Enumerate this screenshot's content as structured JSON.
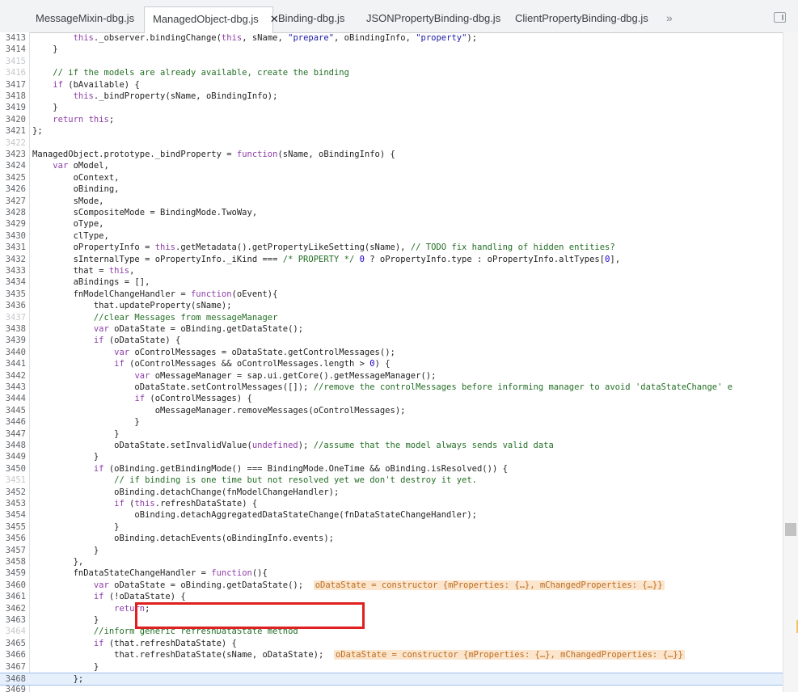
{
  "tabs": [
    {
      "label": "MessageMixin-dbg.js",
      "active": false
    },
    {
      "label": "ManagedObject-dbg.js",
      "active": true
    },
    {
      "label": "Binding-dbg.js",
      "active": false
    },
    {
      "label": "JSONPropertyBinding-dbg.js",
      "active": false
    },
    {
      "label": "ClientPropertyBinding-dbg.js",
      "active": false
    }
  ],
  "close_glyph": "✕",
  "overflow_glyph": "»",
  "execution_line": 3468,
  "lines": [
    {
      "n": "3413",
      "text": "\t\tthis._observer.bindingChange(this, sName, \"prepare\", oBindingInfo, \"property\");"
    },
    {
      "n": "3414",
      "text": "\t}"
    },
    {
      "n": "3415",
      "text": ""
    },
    {
      "n": "3416",
      "text": "\t// if the models are already available, create the binding"
    },
    {
      "n": "3417",
      "text": "\tif (bAvailable) {"
    },
    {
      "n": "3418",
      "text": "\t\tthis._bindProperty(sName, oBindingInfo);"
    },
    {
      "n": "3419",
      "text": "\t}"
    },
    {
      "n": "3420",
      "text": "\treturn this;"
    },
    {
      "n": "3421",
      "text": "};"
    },
    {
      "n": "3422",
      "text": ""
    },
    {
      "n": "3423",
      "text": "ManagedObject.prototype._bindProperty = function(sName, oBindingInfo) {"
    },
    {
      "n": "3424",
      "text": "\tvar oModel,"
    },
    {
      "n": "3425",
      "text": "\t\toContext,"
    },
    {
      "n": "3426",
      "text": "\t\toBinding,"
    },
    {
      "n": "3427",
      "text": "\t\tsMode,"
    },
    {
      "n": "3428",
      "text": "\t\tsCompositeMode = BindingMode.TwoWay,"
    },
    {
      "n": "3429",
      "text": "\t\toType,"
    },
    {
      "n": "3430",
      "text": "\t\tclType,"
    },
    {
      "n": "3431",
      "text": "\t\toPropertyInfo = this.getMetadata().getPropertyLikeSetting(sName), // TODO fix handling of hidden entities?"
    },
    {
      "n": "3432",
      "text": "\t\tsInternalType = oPropertyInfo._iKind === /* PROPERTY */ 0 ? oPropertyInfo.type : oPropertyInfo.altTypes[0],"
    },
    {
      "n": "3433",
      "text": "\t\tthat = this,"
    },
    {
      "n": "3434",
      "text": "\t\taBindings = [],"
    },
    {
      "n": "3435",
      "text": "\t\tfnModelChangeHandler = function(oEvent){"
    },
    {
      "n": "3436",
      "text": "\t\t\tthat.updateProperty(sName);"
    },
    {
      "n": "3437",
      "text": "\t\t\t//clear Messages from messageManager"
    },
    {
      "n": "3438",
      "text": "\t\t\tvar oDataState = oBinding.getDataState();"
    },
    {
      "n": "3439",
      "text": "\t\t\tif (oDataState) {"
    },
    {
      "n": "3440",
      "text": "\t\t\t\tvar oControlMessages = oDataState.getControlMessages();"
    },
    {
      "n": "3441",
      "text": "\t\t\t\tif (oControlMessages && oControlMessages.length > 0) {"
    },
    {
      "n": "3442",
      "text": "\t\t\t\t\tvar oMessageManager = sap.ui.getCore().getMessageManager();"
    },
    {
      "n": "3443",
      "text": "\t\t\t\t\toDataState.setControlMessages([]); //remove the controlMessages before informing manager to avoid 'dataStateChange' e"
    },
    {
      "n": "3444",
      "text": "\t\t\t\t\tif (oControlMessages) {"
    },
    {
      "n": "3445",
      "text": "\t\t\t\t\t\toMessageManager.removeMessages(oControlMessages);"
    },
    {
      "n": "3446",
      "text": "\t\t\t\t\t}"
    },
    {
      "n": "3447",
      "text": "\t\t\t\t}"
    },
    {
      "n": "3448",
      "text": "\t\t\t\toDataState.setInvalidValue(undefined); //assume that the model always sends valid data"
    },
    {
      "n": "3449",
      "text": "\t\t\t}"
    },
    {
      "n": "3450",
      "text": "\t\t\tif (oBinding.getBindingMode() === BindingMode.OneTime && oBinding.isResolved()) {"
    },
    {
      "n": "3451",
      "text": "\t\t\t\t// if binding is one time but not resolved yet we don't destroy it yet."
    },
    {
      "n": "3452",
      "text": "\t\t\t\toBinding.detachChange(fnModelChangeHandler);"
    },
    {
      "n": "3453",
      "text": "\t\t\t\tif (this.refreshDataState) {"
    },
    {
      "n": "3454",
      "text": "\t\t\t\t\toBinding.detachAggregatedDataStateChange(fnDataStateChangeHandler);"
    },
    {
      "n": "3455",
      "text": "\t\t\t\t}"
    },
    {
      "n": "3456",
      "text": "\t\t\t\toBinding.detachEvents(oBindingInfo.events);"
    },
    {
      "n": "3457",
      "text": "\t\t\t}"
    },
    {
      "n": "3458",
      "text": "\t\t},"
    },
    {
      "n": "3459",
      "text": "\t\tfnDataStateChangeHandler = function(){"
    },
    {
      "n": "3460",
      "text": "\t\t\tvar oDataState = oBinding.getDataState();",
      "inline": "oDataState = constructor {mProperties: {…}, mChangedProperties: {…}}"
    },
    {
      "n": "3461",
      "text": "\t\t\tif (!oDataState) {"
    },
    {
      "n": "3462",
      "text": "\t\t\t\treturn;"
    },
    {
      "n": "3463",
      "text": "\t\t\t}"
    },
    {
      "n": "3464",
      "text": "\t\t\t//inform generic refreshDataState method"
    },
    {
      "n": "3465",
      "text": "\t\t\tif (that.refreshDataState) {"
    },
    {
      "n": "3466",
      "text": "\t\t\t\tthat.refreshDataState(sName, oDataState);",
      "inline": "oDataState = constructor {mProperties: {…}, mChangedProperties: {…}}"
    },
    {
      "n": "3467",
      "text": "\t\t\t}"
    },
    {
      "n": "3468",
      "text": "\t\t};"
    },
    {
      "n": "3469",
      "text": ""
    }
  ]
}
